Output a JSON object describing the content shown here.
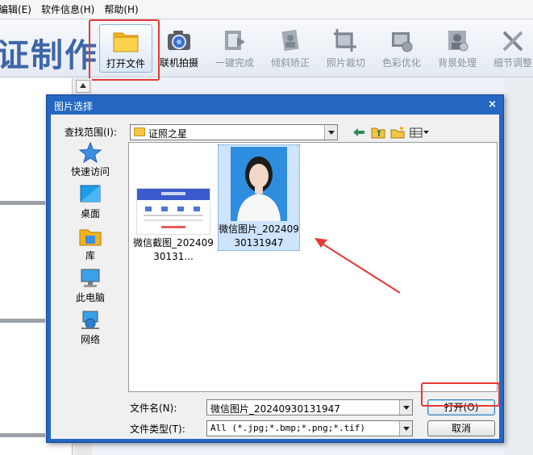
{
  "menubar": {
    "items": [
      "编辑(E)",
      "软件信息(H)",
      "帮助(H)"
    ]
  },
  "toolbar": {
    "brand": "证制作",
    "tools": [
      {
        "label": "打开文件",
        "icon": "folder-icon",
        "enabled": true,
        "highlighted": true
      },
      {
        "label": "联机拍摄",
        "icon": "camera-icon",
        "enabled": true
      },
      {
        "label": "一键完成",
        "icon": "film-icon",
        "enabled": false
      },
      {
        "label": "倾斜矫正",
        "icon": "tilt-icon",
        "enabled": false
      },
      {
        "label": "照片裁切",
        "icon": "crop-icon",
        "enabled": false
      },
      {
        "label": "色彩优化",
        "icon": "color-icon",
        "enabled": false
      },
      {
        "label": "背景处理",
        "icon": "background-icon",
        "enabled": false
      },
      {
        "label": "细节调整",
        "icon": "tools-icon",
        "enabled": false
      }
    ]
  },
  "dialog": {
    "title": "图片选择",
    "close_icon": "close-icon",
    "lookin_label": "查找范围(I):",
    "lookin_value": "证照之星",
    "places": [
      {
        "label": "快速访问",
        "icon": "star-icon"
      },
      {
        "label": "桌面",
        "icon": "desktop-icon"
      },
      {
        "label": "库",
        "icon": "library-icon"
      },
      {
        "label": "此电脑",
        "icon": "computer-icon"
      },
      {
        "label": "网络",
        "icon": "network-icon"
      }
    ],
    "files": [
      {
        "name": "微信截图_20240930131...",
        "selected": false
      },
      {
        "name": "微信图片_20240930131947",
        "selected": true
      }
    ],
    "filename_label": "文件名(N):",
    "filename_value": "微信图片_20240930131947",
    "filetype_label": "文件类型(T):",
    "filetype_value": "All (*.jpg;*.bmp;*.png;*.tif)",
    "open_button": "打开(O)",
    "cancel_button": "取消"
  },
  "colors": {
    "accent_blue": "#2468c4",
    "highlight_red": "#e53935",
    "brand_blue": "#3e66a8"
  }
}
